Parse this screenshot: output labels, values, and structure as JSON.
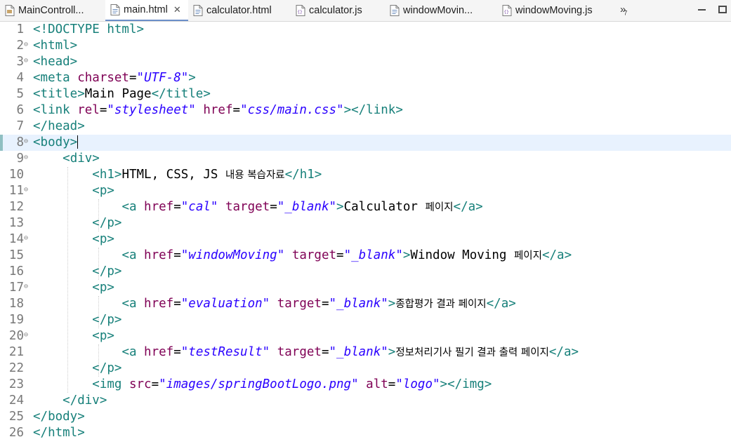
{
  "tabs": [
    {
      "label": "MainControll...",
      "icon": "java-file-icon",
      "active": false
    },
    {
      "label": "main.html",
      "icon": "html-file-icon",
      "active": true,
      "closable": true
    },
    {
      "label": "calculator.html",
      "icon": "html-file-icon",
      "active": false
    },
    {
      "label": "calculator.js",
      "icon": "js-file-icon",
      "active": false
    },
    {
      "label": "windowMovin...",
      "icon": "html-file-icon",
      "active": false
    },
    {
      "label": "windowMoving.js",
      "icon": "js-file-icon",
      "active": false
    }
  ],
  "tab_overflow": {
    "arrows": "»",
    "count": "7"
  },
  "editor": {
    "current_line": 8,
    "lines": [
      {
        "n": "1",
        "fold": false,
        "tokens": [
          [
            "tag",
            "<!DOCTYPE html>"
          ]
        ]
      },
      {
        "n": "2",
        "fold": true,
        "tokens": [
          [
            "tag",
            "<html>"
          ]
        ]
      },
      {
        "n": "3",
        "fold": true,
        "tokens": [
          [
            "tag",
            "<head>"
          ]
        ]
      },
      {
        "n": "4",
        "fold": false,
        "tokens": [
          [
            "tag",
            "<meta "
          ],
          [
            "an",
            "charset"
          ],
          [
            "tx",
            "="
          ],
          [
            "av",
            "\"UTF-8\""
          ],
          [
            "tag",
            ">"
          ]
        ]
      },
      {
        "n": "5",
        "fold": false,
        "tokens": [
          [
            "tag",
            "<title>"
          ],
          [
            "tx",
            "Main Page"
          ],
          [
            "tag",
            "</title>"
          ]
        ]
      },
      {
        "n": "6",
        "fold": false,
        "tokens": [
          [
            "tag",
            "<link "
          ],
          [
            "an",
            "rel"
          ],
          [
            "tx",
            "="
          ],
          [
            "av",
            "\"stylesheet\""
          ],
          [
            "tx",
            " "
          ],
          [
            "an",
            "href"
          ],
          [
            "tx",
            "="
          ],
          [
            "av",
            "\"css/main.css\""
          ],
          [
            "tag",
            "></link>"
          ]
        ]
      },
      {
        "n": "7",
        "fold": false,
        "tokens": [
          [
            "tag",
            "</head>"
          ]
        ]
      },
      {
        "n": "8",
        "fold": true,
        "tokens": [
          [
            "tag",
            "<body>"
          ]
        ]
      },
      {
        "n": "9",
        "fold": true,
        "tokens": [
          [
            "tx",
            "    "
          ],
          [
            "tag",
            "<div>"
          ]
        ]
      },
      {
        "n": "10",
        "fold": false,
        "tokens": [
          [
            "tx",
            "        "
          ],
          [
            "tag",
            "<h1>"
          ],
          [
            "tx",
            "HTML, CSS, JS "
          ],
          [
            "ko",
            "내용 복습자료"
          ],
          [
            "tag",
            "</h1>"
          ]
        ]
      },
      {
        "n": "11",
        "fold": true,
        "tokens": [
          [
            "tx",
            "        "
          ],
          [
            "tag",
            "<p>"
          ]
        ]
      },
      {
        "n": "12",
        "fold": false,
        "tokens": [
          [
            "tx",
            "            "
          ],
          [
            "tag",
            "<a "
          ],
          [
            "an",
            "href"
          ],
          [
            "tx",
            "="
          ],
          [
            "av",
            "\"cal\""
          ],
          [
            "tx",
            " "
          ],
          [
            "an",
            "target"
          ],
          [
            "tx",
            "="
          ],
          [
            "av",
            "\"_blank\""
          ],
          [
            "tag",
            ">"
          ],
          [
            "tx",
            "Calculator "
          ],
          [
            "ko",
            "페이지"
          ],
          [
            "tag",
            "</a>"
          ]
        ]
      },
      {
        "n": "13",
        "fold": false,
        "tokens": [
          [
            "tx",
            "        "
          ],
          [
            "tag",
            "</p>"
          ]
        ]
      },
      {
        "n": "14",
        "fold": true,
        "tokens": [
          [
            "tx",
            "        "
          ],
          [
            "tag",
            "<p>"
          ]
        ]
      },
      {
        "n": "15",
        "fold": false,
        "tokens": [
          [
            "tx",
            "            "
          ],
          [
            "tag",
            "<a "
          ],
          [
            "an",
            "href"
          ],
          [
            "tx",
            "="
          ],
          [
            "av",
            "\"windowMoving\""
          ],
          [
            "tx",
            " "
          ],
          [
            "an",
            "target"
          ],
          [
            "tx",
            "="
          ],
          [
            "av",
            "\"_blank\""
          ],
          [
            "tag",
            ">"
          ],
          [
            "tx",
            "Window Moving "
          ],
          [
            "ko",
            "페이지"
          ],
          [
            "tag",
            "</a>"
          ]
        ]
      },
      {
        "n": "16",
        "fold": false,
        "tokens": [
          [
            "tx",
            "        "
          ],
          [
            "tag",
            "</p>"
          ]
        ]
      },
      {
        "n": "17",
        "fold": true,
        "tokens": [
          [
            "tx",
            "        "
          ],
          [
            "tag",
            "<p>"
          ]
        ]
      },
      {
        "n": "18",
        "fold": false,
        "tokens": [
          [
            "tx",
            "            "
          ],
          [
            "tag",
            "<a "
          ],
          [
            "an",
            "href"
          ],
          [
            "tx",
            "="
          ],
          [
            "av",
            "\"evaluation\""
          ],
          [
            "tx",
            " "
          ],
          [
            "an",
            "target"
          ],
          [
            "tx",
            "="
          ],
          [
            "av",
            "\"_blank\""
          ],
          [
            "tag",
            ">"
          ],
          [
            "ko",
            "종합평가 결과 페이지"
          ],
          [
            "tag",
            "</a>"
          ]
        ]
      },
      {
        "n": "19",
        "fold": false,
        "tokens": [
          [
            "tx",
            "        "
          ],
          [
            "tag",
            "</p>"
          ]
        ]
      },
      {
        "n": "20",
        "fold": true,
        "tokens": [
          [
            "tx",
            "        "
          ],
          [
            "tag",
            "<p>"
          ]
        ]
      },
      {
        "n": "21",
        "fold": false,
        "tokens": [
          [
            "tx",
            "            "
          ],
          [
            "tag",
            "<a "
          ],
          [
            "an",
            "href"
          ],
          [
            "tx",
            "="
          ],
          [
            "av",
            "\"testResult\""
          ],
          [
            "tx",
            " "
          ],
          [
            "an",
            "target"
          ],
          [
            "tx",
            "="
          ],
          [
            "av",
            "\"_blank\""
          ],
          [
            "tag",
            ">"
          ],
          [
            "ko",
            "정보처리기사 필기 결과 출력 페이지"
          ],
          [
            "tag",
            "</a>"
          ]
        ]
      },
      {
        "n": "22",
        "fold": false,
        "tokens": [
          [
            "tx",
            "        "
          ],
          [
            "tag",
            "</p>"
          ]
        ]
      },
      {
        "n": "23",
        "fold": false,
        "tokens": [
          [
            "tx",
            "        "
          ],
          [
            "tag",
            "<img "
          ],
          [
            "an",
            "src"
          ],
          [
            "tx",
            "="
          ],
          [
            "av",
            "\"images/springBootLogo.png\""
          ],
          [
            "tx",
            " "
          ],
          [
            "an",
            "alt"
          ],
          [
            "tx",
            "="
          ],
          [
            "av",
            "\"logo\""
          ],
          [
            "tag",
            "></img>"
          ]
        ]
      },
      {
        "n": "24",
        "fold": false,
        "tokens": [
          [
            "tx",
            "    "
          ],
          [
            "tag",
            "</div>"
          ]
        ]
      },
      {
        "n": "25",
        "fold": false,
        "tokens": [
          [
            "tag",
            "</body>"
          ]
        ]
      },
      {
        "n": "26",
        "fold": false,
        "tokens": [
          [
            "tag",
            "</html>"
          ]
        ]
      }
    ]
  },
  "colors": {
    "tag": "#17807a",
    "attr_name": "#7f0055",
    "attr_value": "#2a00ff",
    "text": "#000000",
    "current_line": "#e8f2fe",
    "active_tab_underline": "#6b8ec9"
  }
}
